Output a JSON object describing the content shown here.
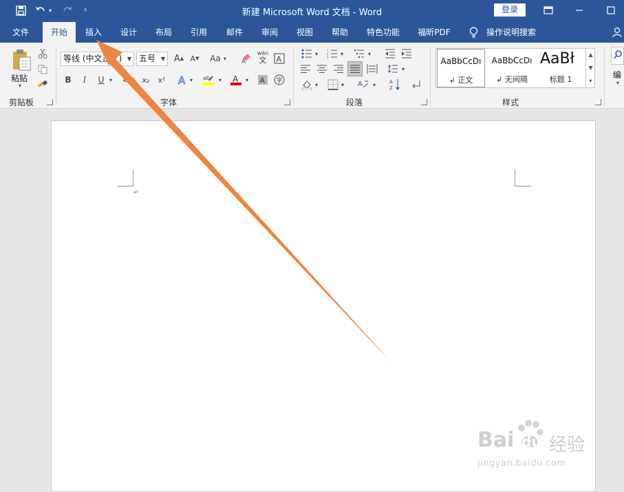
{
  "window": {
    "title": "新建 Microsoft Word 文档  -  Word",
    "login_label": "登录"
  },
  "tabs": [
    {
      "label": "文件",
      "active": false
    },
    {
      "label": "开始",
      "active": true
    },
    {
      "label": "插入",
      "active": false
    },
    {
      "label": "设计",
      "active": false
    },
    {
      "label": "布局",
      "active": false
    },
    {
      "label": "引用",
      "active": false
    },
    {
      "label": "邮件",
      "active": false
    },
    {
      "label": "审阅",
      "active": false
    },
    {
      "label": "视图",
      "active": false
    },
    {
      "label": "帮助",
      "active": false
    },
    {
      "label": "特色功能",
      "active": false
    },
    {
      "label": "福昕PDF",
      "active": false
    }
  ],
  "tell_me": "操作说明搜索",
  "ribbon": {
    "clipboard": {
      "label": "剪贴板",
      "paste_label": "粘贴"
    },
    "font": {
      "label": "字体",
      "font_name": "等线 (中文正文)",
      "font_size": "五号",
      "grow": "A",
      "shrink": "A",
      "change_case": "Aa",
      "phonetic_top": "wén",
      "phonetic_bottom": "文",
      "bold": "B",
      "italic": "I",
      "underline": "U",
      "strike": "abc",
      "subscript": "x₂",
      "superscript": "x²"
    },
    "paragraph": {
      "label": "段落"
    },
    "styles": {
      "label": "样式",
      "items": [
        {
          "preview": "AaBbCcDı",
          "name": "↲ 正文"
        },
        {
          "preview": "AaBbCcDı",
          "name": "↲ 无间隔"
        },
        {
          "preview": "AaBł",
          "name": "标题 1"
        }
      ]
    },
    "editing": {
      "label": "编"
    }
  },
  "watermark": {
    "brand": "Bai",
    "brand_tail": "du",
    "cn": "经验",
    "url": "jingyan.baidu.com"
  },
  "colors": {
    "accent": "#2b579a",
    "highlight": "#ffff00",
    "font_color": "#e00000",
    "arrow": "#f0843c"
  }
}
